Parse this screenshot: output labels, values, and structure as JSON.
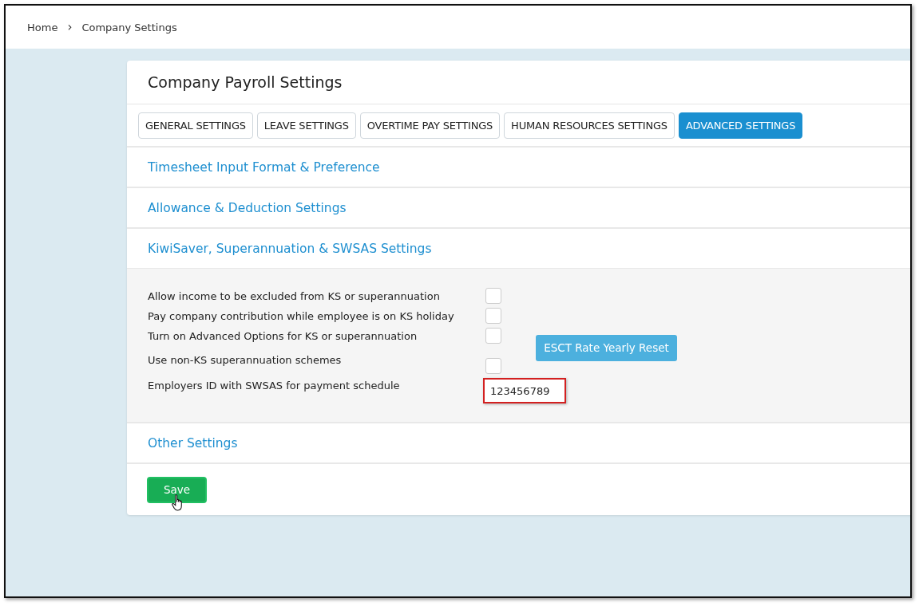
{
  "breadcrumb": {
    "items": [
      "Home",
      "Company Settings"
    ],
    "separator": "›"
  },
  "page_title": "Company Payroll Settings",
  "tabs": [
    {
      "label": "GENERAL SETTINGS",
      "selected": false
    },
    {
      "label": "LEAVE SETTINGS",
      "selected": false
    },
    {
      "label": "OVERTIME PAY SETTINGS",
      "selected": false
    },
    {
      "label": "HUMAN RESOURCES SETTINGS",
      "selected": false
    },
    {
      "label": "ADVANCED SETTINGS",
      "selected": true
    }
  ],
  "sections": [
    {
      "title": "Timesheet Input Format & Preference"
    },
    {
      "title": "Allowance & Deduction Settings"
    },
    {
      "title": "KiwiSaver, Superannuation & SWSAS Settings",
      "fields": [
        {
          "kind": "checkbox",
          "label": "Allow income to be excluded from KS or superannuation",
          "checked": false
        },
        {
          "kind": "checkbox",
          "label": "Pay company contribution while employee is on KS holiday",
          "checked": false
        },
        {
          "kind": "checkbox",
          "label": "Turn on Advanced Options for KS or superannuation",
          "checked": false
        },
        {
          "kind": "checkbox",
          "label": "Use non-KS superannuation schemes",
          "checked": false
        },
        {
          "kind": "text",
          "label": "Employers ID with SWSAS for payment schedule",
          "value": "123456789",
          "highlighted": true
        }
      ],
      "action_button": "ESCT Rate Yearly Reset"
    },
    {
      "title": "Other Settings"
    }
  ],
  "save_button": "Save"
}
